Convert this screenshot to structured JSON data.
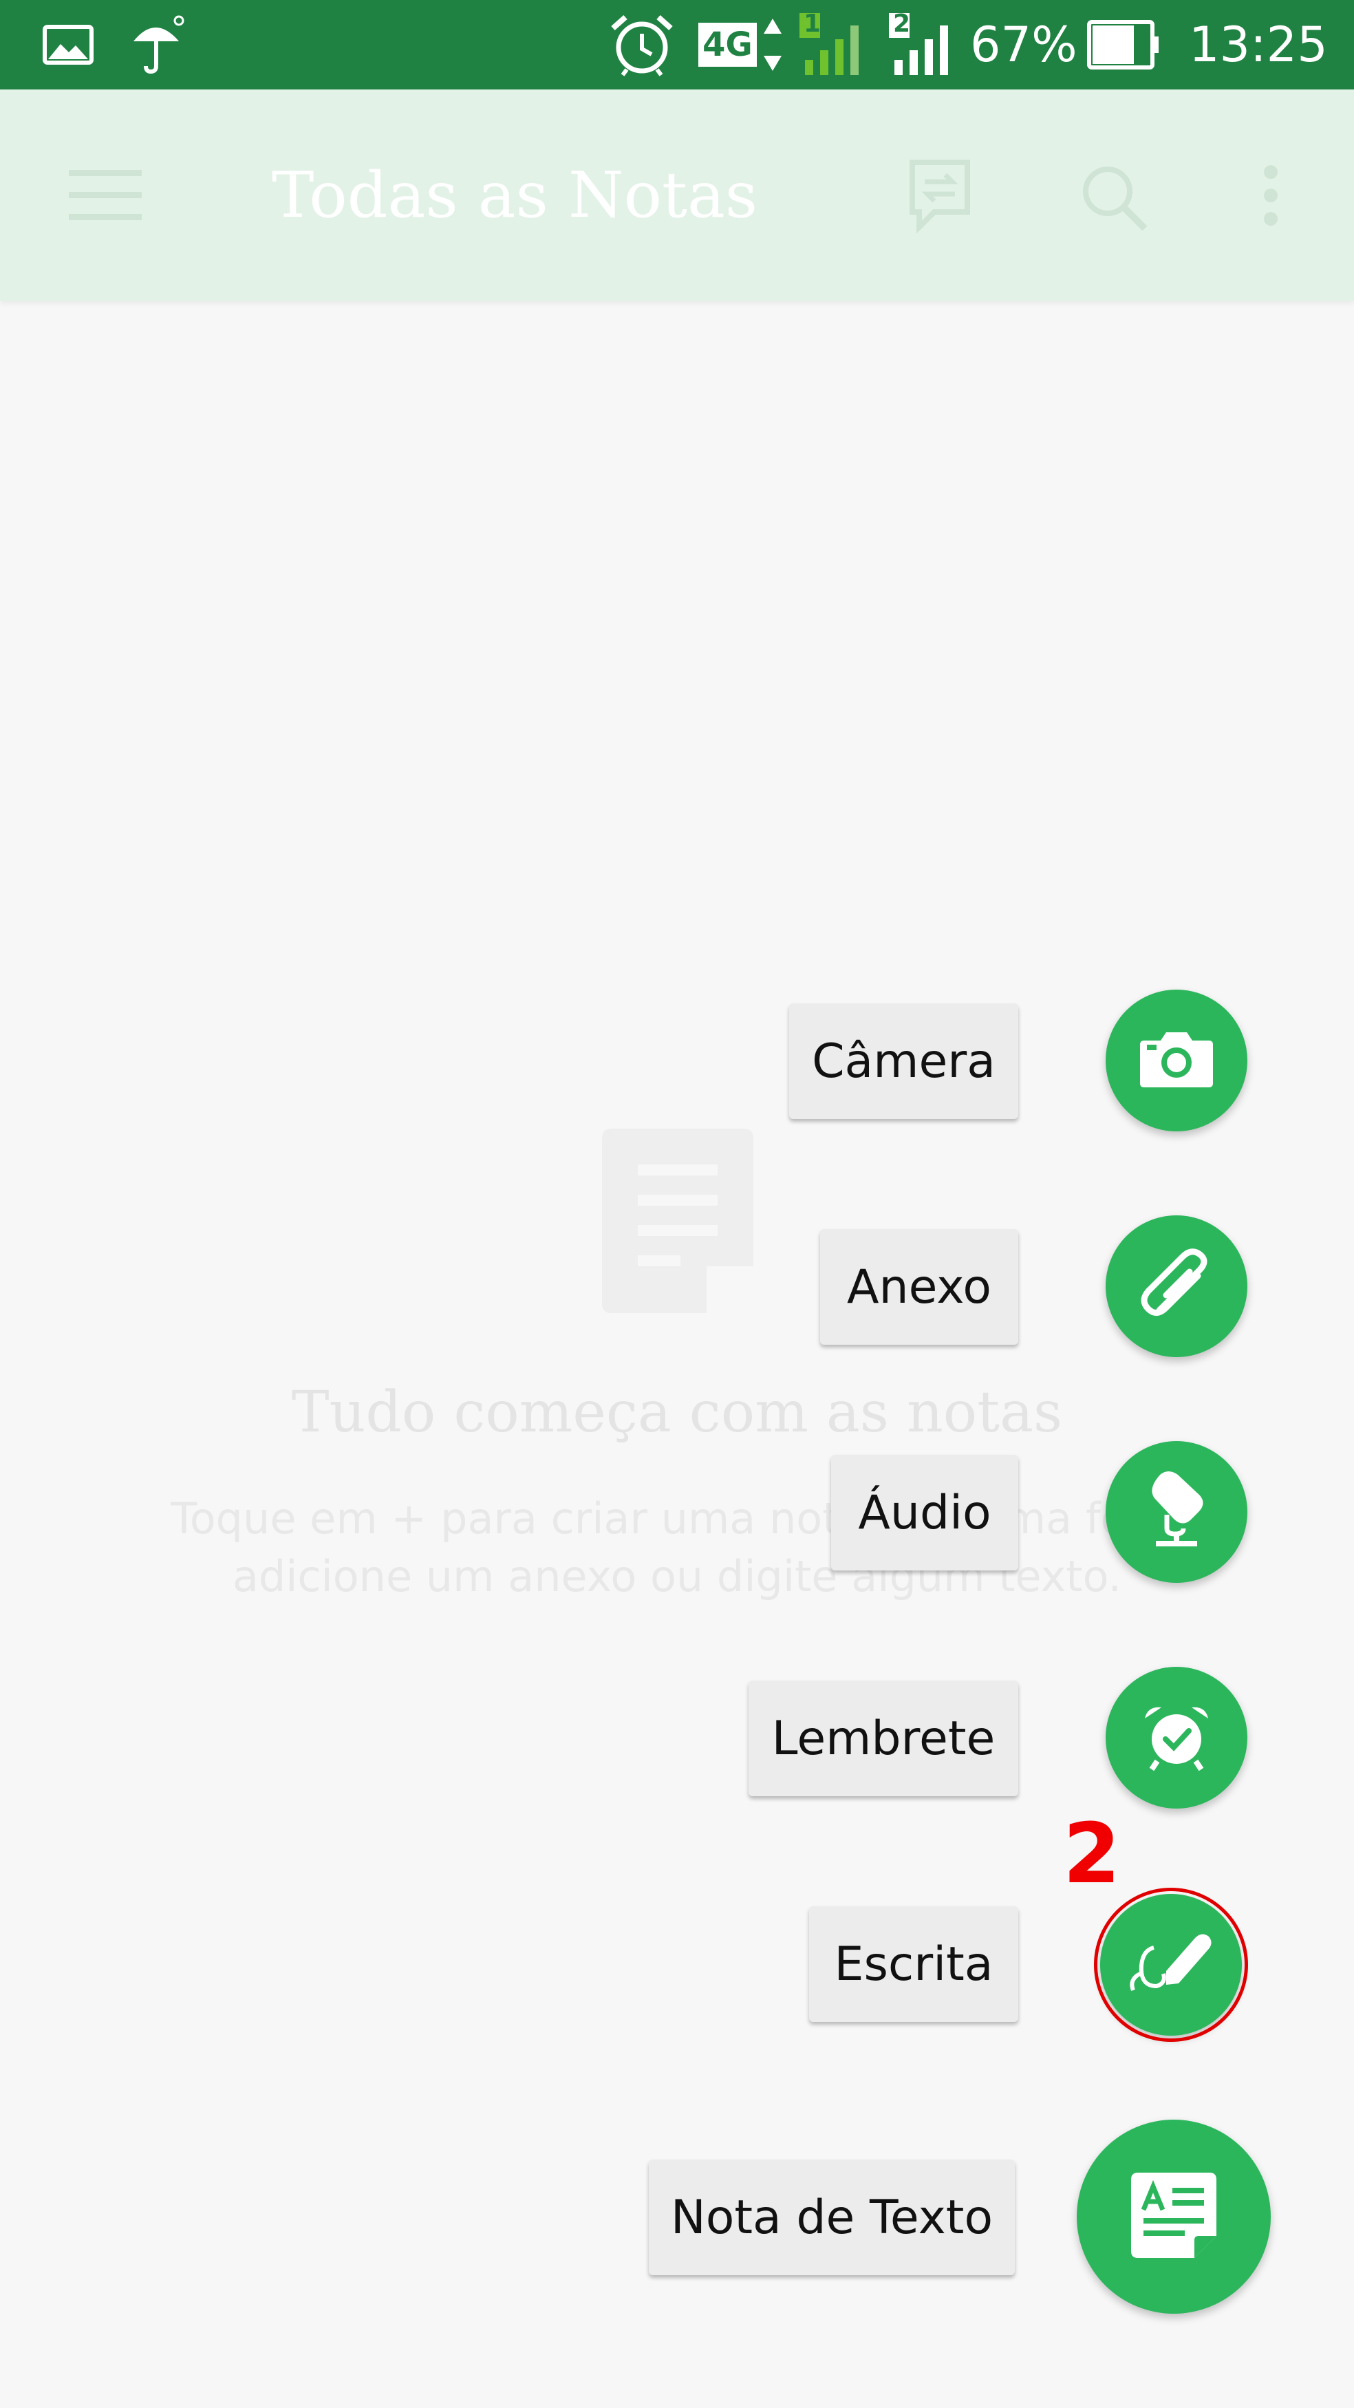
{
  "status_bar": {
    "battery": "67%",
    "time": "13:25",
    "network": "4G",
    "sim1": "1",
    "sim2": "2",
    "icons": [
      "image-icon",
      "umbrella-icon",
      "alarm-icon",
      "network-4g-icon",
      "signal-sim1-icon",
      "signal-sim2-icon",
      "battery-icon"
    ]
  },
  "app_bar": {
    "title": "Todas as Notas",
    "icons": [
      "menu-icon",
      "sync-icon",
      "search-icon",
      "more-vert-icon"
    ]
  },
  "empty_state": {
    "title": "Tudo começa com as notas",
    "subtitle": "Toque em + para criar uma nota, tire uma foto, adicione um anexo ou digite algum texto."
  },
  "fab_menu": {
    "items": [
      {
        "label": "Câmera",
        "icon": "camera-icon"
      },
      {
        "label": "Anexo",
        "icon": "paperclip-icon"
      },
      {
        "label": "Áudio",
        "icon": "microphone-icon"
      },
      {
        "label": "Lembrete",
        "icon": "alarm-check-icon"
      },
      {
        "label": "Escrita",
        "icon": "handwriting-pen-icon"
      },
      {
        "label": "Nota de Texto",
        "icon": "text-note-icon"
      }
    ]
  },
  "annotation": {
    "label": "2"
  },
  "colors": {
    "status_bar": "#1f8242",
    "accent": "#2cb65c",
    "highlight": "#e00000"
  }
}
